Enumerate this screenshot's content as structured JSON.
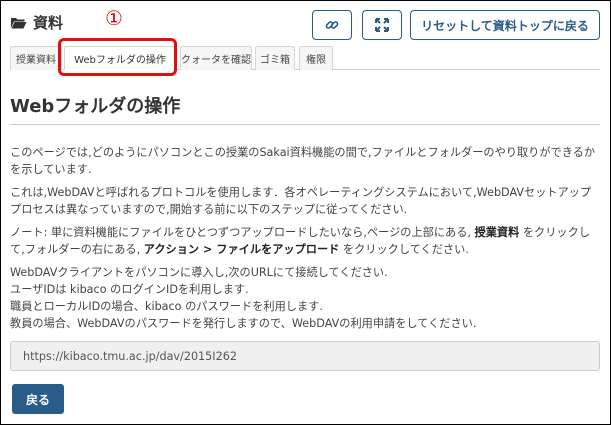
{
  "tool": {
    "title": "資料",
    "icon": "folder-open-icon"
  },
  "annotation": {
    "marker": "①"
  },
  "toolbar": {
    "link_icon": "link-icon",
    "expand_icon": "expand-icon",
    "reset_label": "リセットして資料トップに戻る"
  },
  "tabs": [
    {
      "label": "授業資料",
      "active": false
    },
    {
      "label": "Webフォルダの操作",
      "active": true
    },
    {
      "label": "クォータを確認",
      "active": false
    },
    {
      "label": "ゴミ箱",
      "active": false
    },
    {
      "label": "権限",
      "active": false
    }
  ],
  "main": {
    "page_title": "Webフォルダの操作",
    "p1": "このページでは,どのようにパソコンとこの授業のSakai資料機能の間で,ファイルとフォルダーのやり取りができるかを示しています.",
    "p2": "これは,WebDAVと呼ばれるプロトコルを使用します．各オペレーティングシステムにおいて,WebDAVセットアッププロセスは異なっていますので,開始する前に以下のステップに従ってください.",
    "p3": {
      "pre": "ノート: 単に資料機能にファイルをひとつずつアップロードしたいなら,ページの上部にある, ",
      "bold1": "授業資料",
      "mid": " をクリックして,フォルダーの右にある, ",
      "bold2": "アクション > ファイルをアップロード",
      "post": " をクリックしてください."
    },
    "p4": [
      "WebDAVクライアントをパソコンに導入し,次のURLにて接続してください.",
      "ユーザIDは kibaco のログインIDを利用します.",
      "職員とローカルIDの場合、kibaco のパスワードを利用します.",
      "教員の場合、WebDAVのパスワードを発行しますので、WebDAVの利用申請をしてください."
    ],
    "url": "https://kibaco.tmu.ac.jp/dav/2015I262",
    "back_label": "戻る"
  },
  "colors": {
    "accent": "#2a5c8a",
    "highlight": "#e01010",
    "rule": "#cccccc"
  }
}
